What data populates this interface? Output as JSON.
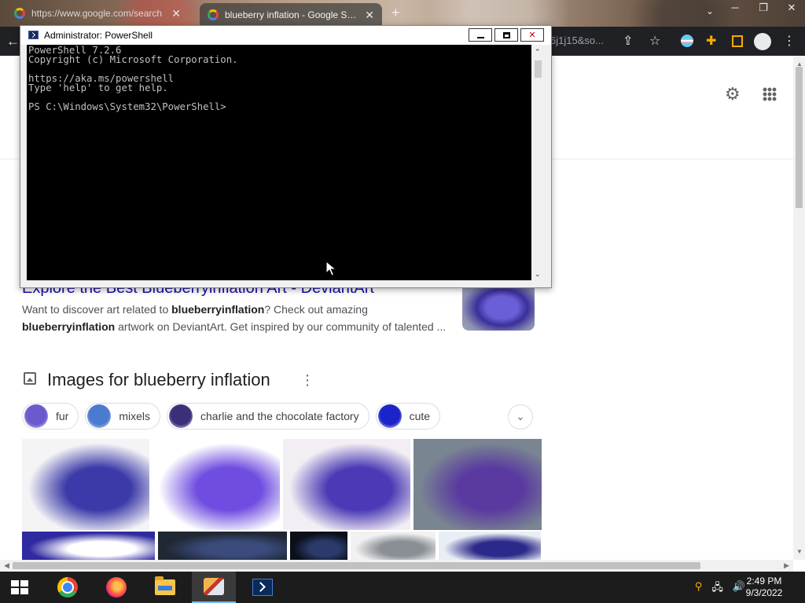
{
  "browser": {
    "tabs": [
      {
        "title": "https://www.google.com/search",
        "active": false
      },
      {
        "title": "blueberry inflation - Google Search",
        "active": true
      }
    ],
    "url_partial": "6j1j15&so..."
  },
  "google": {
    "result": {
      "title": "Explore the Best Blueberryinflation Art - DeviantArt",
      "snippet_parts": {
        "p1": "Want to discover art related to ",
        "b1": "blueberryinflation",
        "p2": "? Check out amazing ",
        "b2": "blueberryinflation",
        "p3": " artwork on DeviantArt. Get inspired by our community of talented ..."
      }
    },
    "images_heading": "Images for blueberry inflation",
    "chips": [
      {
        "label": "fur",
        "color": "#6a5acd"
      },
      {
        "label": "mixels",
        "color": "#4a7bd0"
      },
      {
        "label": "charlie and the chocolate factory",
        "color": "#3b2f7a"
      },
      {
        "label": "cute",
        "color": "#1c24c9"
      }
    ],
    "image_tiles_row1": [
      {
        "width": 162,
        "bg": "#f4f4f6",
        "accent": "#3b3aa8"
      },
      {
        "width": 162,
        "bg": "#ffffff",
        "accent": "#6f4de0"
      },
      {
        "width": 162,
        "bg": "#f3eef4",
        "accent": "#4a3ab5"
      },
      {
        "width": 163,
        "bg": "#7a8592",
        "accent": "#5a3aa0"
      }
    ],
    "image_tiles_row2": [
      {
        "width": 169,
        "bg": "#2f2aa0",
        "accent": "#ffffff"
      },
      {
        "width": 164,
        "bg": "#1f2833",
        "accent": "#3a4a7a"
      },
      {
        "width": 73,
        "bg": "#0a0f18",
        "accent": "#2b3a6a"
      },
      {
        "width": 108,
        "bg": "#f1f1f1",
        "accent": "#8a8f96"
      },
      {
        "width": 130,
        "bg": "#e9eef5",
        "accent": "#2b2a8a"
      }
    ]
  },
  "powershell": {
    "title": "Administrator: PowerShell",
    "lines": [
      "PowerShell 7.2.6",
      "Copyright (c) Microsoft Corporation.",
      "",
      "https://aka.ms/powershell",
      "Type 'help' to get help.",
      "",
      "PS C:\\Windows\\System32\\PowerShell>"
    ]
  },
  "taskbar": {
    "apps": [
      {
        "name": "chrome",
        "active": false
      },
      {
        "name": "firefox",
        "active": false
      },
      {
        "name": "file-explorer",
        "active": false
      },
      {
        "name": "tools",
        "active": true
      },
      {
        "name": "powershell",
        "active": false
      }
    ],
    "time": "2:49 PM",
    "date": "9/3/2022"
  },
  "icons": {
    "back": "arrow-left-icon",
    "share": "share-icon",
    "bookmark": "star-icon",
    "extensions": "puzzle-icon",
    "settings": "gear-icon",
    "apps": "grid-icon"
  }
}
